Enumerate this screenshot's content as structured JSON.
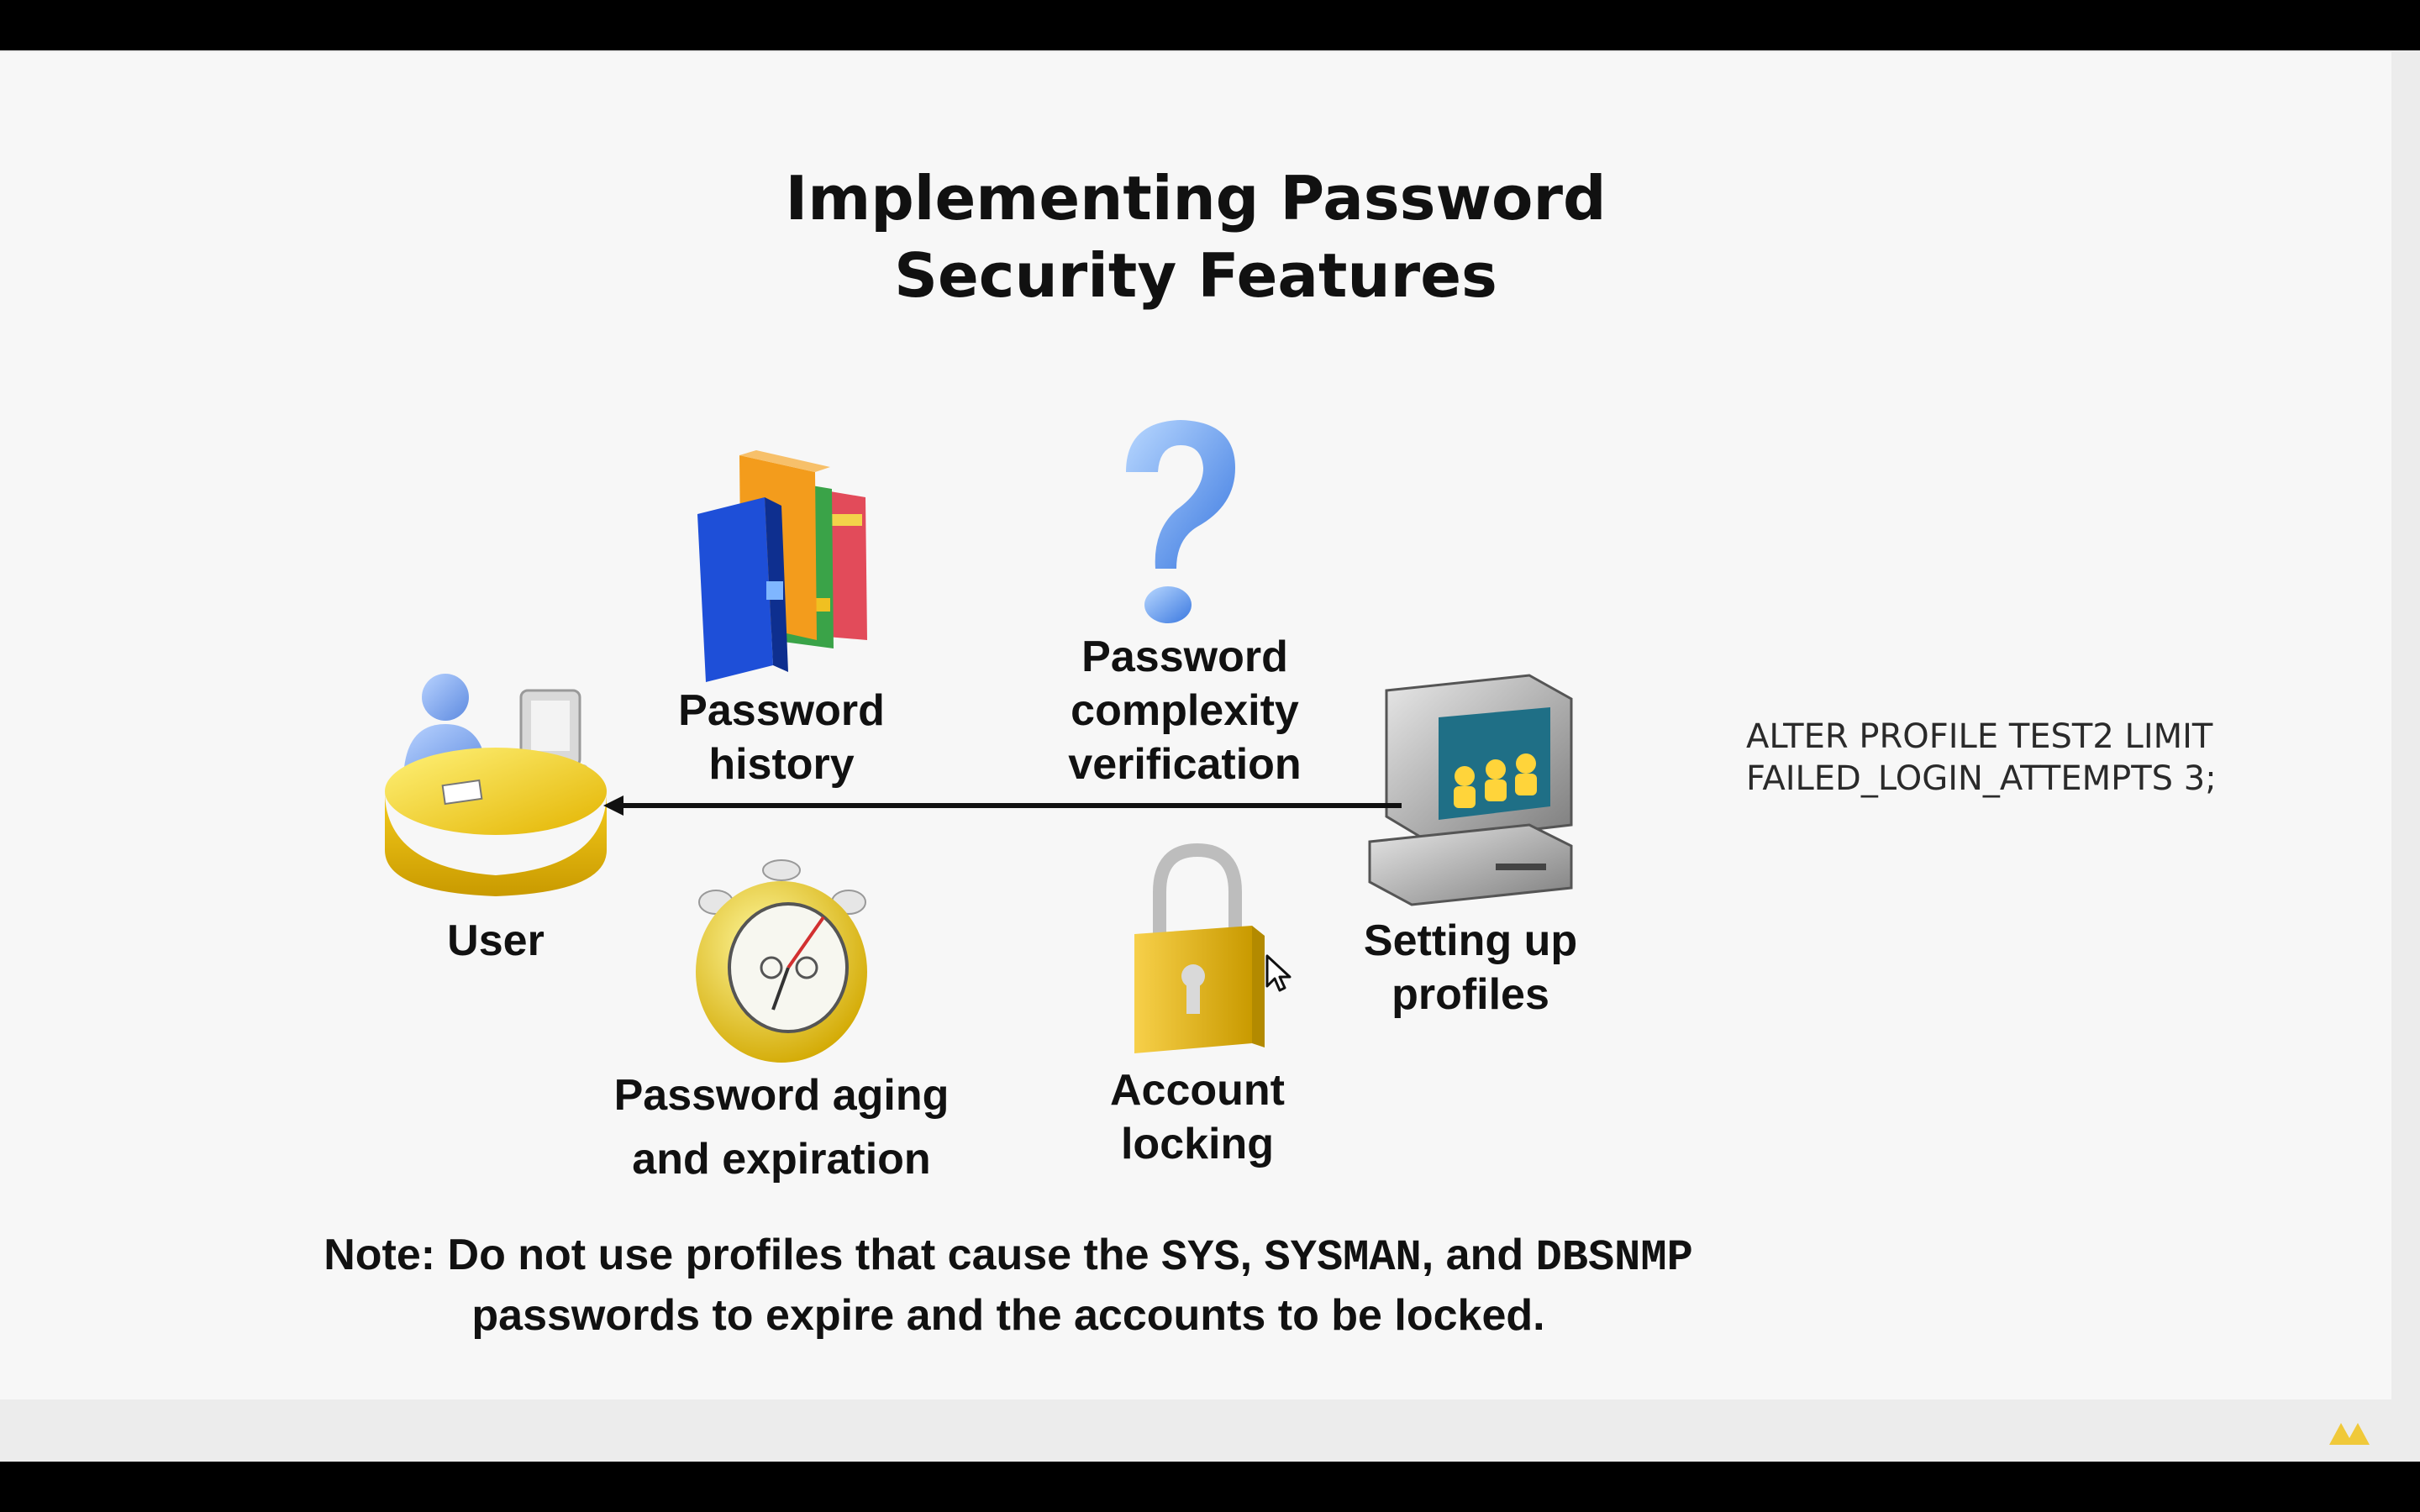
{
  "slide": {
    "title_line1": "Implementing Password",
    "title_line2": "Security Features",
    "labels": {
      "user": "User",
      "password_history_line1": "Password",
      "password_history_line2": "history",
      "complexity_line1": "Password",
      "complexity_line2": "complexity",
      "complexity_line3": "verification",
      "setting_up_line1": "Setting up",
      "setting_up_line2": "profiles",
      "aging_line1": "Password aging",
      "aging_line2": "and expiration",
      "locking_line1": "Account",
      "locking_line2": "locking"
    },
    "note": {
      "prefix": "Note: Do not use profiles that cause the ",
      "sys": "SYS",
      "comma1": ", ",
      "sysman": "SYSMAN",
      "and": ", and ",
      "dbsnmp": "DBSNMP",
      "line2": "passwords to expire and the accounts to be locked."
    }
  },
  "overlay_text": {
    "line1": "ALTER PROFILE TEST2 LIMIT",
    "line2": "FAILED_LOGIN_ATTEMPTS 3;"
  },
  "icons": {
    "user": "user-at-desk-icon",
    "books": "books-icon",
    "question": "question-mark-icon",
    "computer": "computer-profiles-icon",
    "stopwatch": "stopwatch-icon",
    "padlock": "padlock-icon",
    "cursor": "move-cursor-icon",
    "logo": "watermark-logo-icon"
  },
  "colors": {
    "background": "#f7f7f7",
    "text": "#111111",
    "yellow": "#f2c318",
    "blue": "#1e4fd8"
  }
}
